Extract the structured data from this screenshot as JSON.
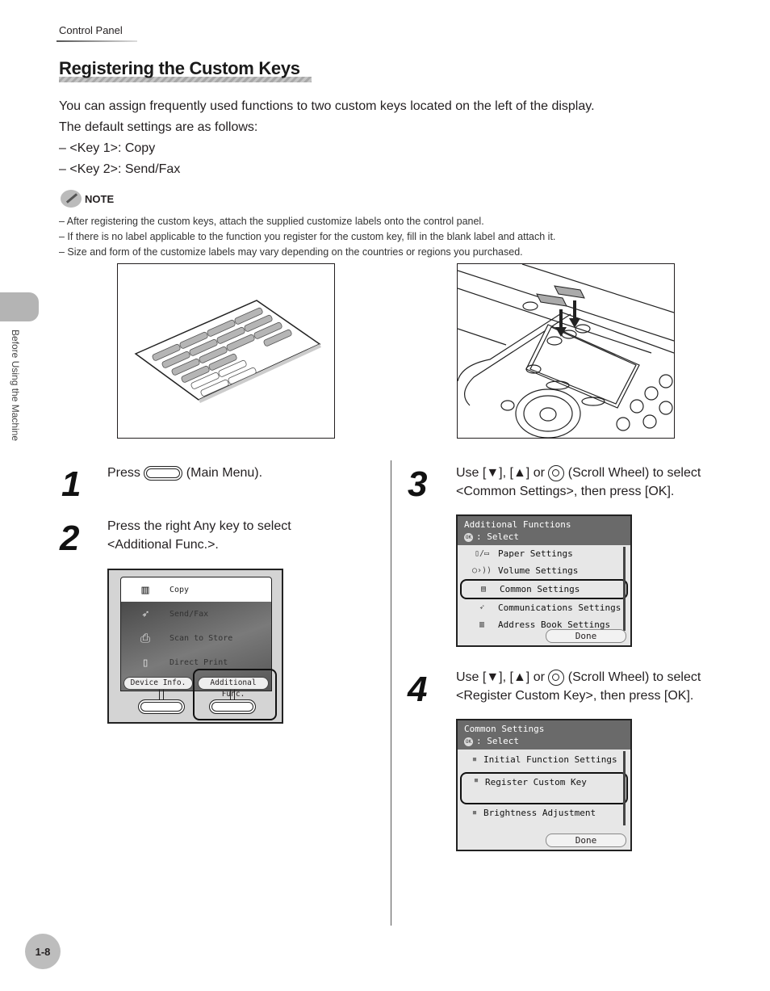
{
  "header": {
    "section": "Control Panel",
    "title": "Registering the Custom Keys"
  },
  "intro": {
    "line1": "You can assign frequently used functions to two custom keys located on the left of the display.",
    "line2": "The default settings are as follows:",
    "defaults": [
      "–  <Key 1>: Copy",
      "–  <Key 2>: Send/Fax"
    ]
  },
  "note": {
    "label": "NOTE",
    "items": [
      "–   After registering the custom keys, attach the supplied customize labels onto the control panel.",
      "–   If there is no label applicable to the function you register for the custom key, fill in the blank label and attach it.",
      "–   Size and form of the customize labels may vary depending on the countries or regions you purchased."
    ]
  },
  "side_tab": {
    "label": "Before Using the Machine"
  },
  "steps": [
    {
      "number": "1",
      "text_before": "Press ",
      "icon": "main-menu-key-icon",
      "text_after": " (Main Menu)."
    },
    {
      "number": "2",
      "line1": "Press the right Any key to select",
      "line2": "<Additional Func.>."
    },
    {
      "number": "3",
      "pre": "Use [▼], [▲] or ",
      "icon": "scroll-wheel-icon",
      "post": " (Scroll Wheel) to select",
      "line2": "<Common Settings>, then press [OK]."
    },
    {
      "number": "4",
      "pre": "Use [▼], [▲] or ",
      "icon": "scroll-wheel-icon",
      "post": " (Scroll Wheel) to select",
      "line2": "<Register Custom Key>, then press [OK]."
    }
  ],
  "main_menu_screen": {
    "items": [
      {
        "label": "Copy",
        "icon": "copy-icon"
      },
      {
        "label": "Send/Fax",
        "icon": "send-fax-icon"
      },
      {
        "label": "Scan to Store",
        "icon": "scanner-icon"
      },
      {
        "label": "Direct Print",
        "icon": "usb-print-icon"
      }
    ],
    "left_button": "Device Info.",
    "right_button": "Additional Func.",
    "highlighted": "Additional Func."
  },
  "additional_functions_screen": {
    "title": "Additional Functions",
    "ok_badge": "OK",
    "subtitle": ": Select",
    "items": [
      {
        "label": "Paper Settings",
        "icon": "▯/▭"
      },
      {
        "label": "Volume Settings",
        "icon": "○›))"
      },
      {
        "label": "Common Settings",
        "icon": "▤"
      },
      {
        "label": "Communications Settings",
        "icon": "➶"
      },
      {
        "label": "Address Book Settings",
        "icon": "▥"
      }
    ],
    "selected": "Common Settings",
    "done": "Done"
  },
  "common_settings_screen": {
    "title": "Common Settings",
    "ok_badge": "OK",
    "subtitle": ": Select",
    "items": [
      {
        "label": "Initial Function Settings",
        "icon": "■"
      },
      {
        "label": "Register Custom Key",
        "icon": "■"
      },
      {
        "label": "Brightness Adjustment",
        "icon": "■"
      }
    ],
    "selected": "Register Custom Key",
    "done": "Done"
  },
  "footer": {
    "page": "1-8"
  }
}
